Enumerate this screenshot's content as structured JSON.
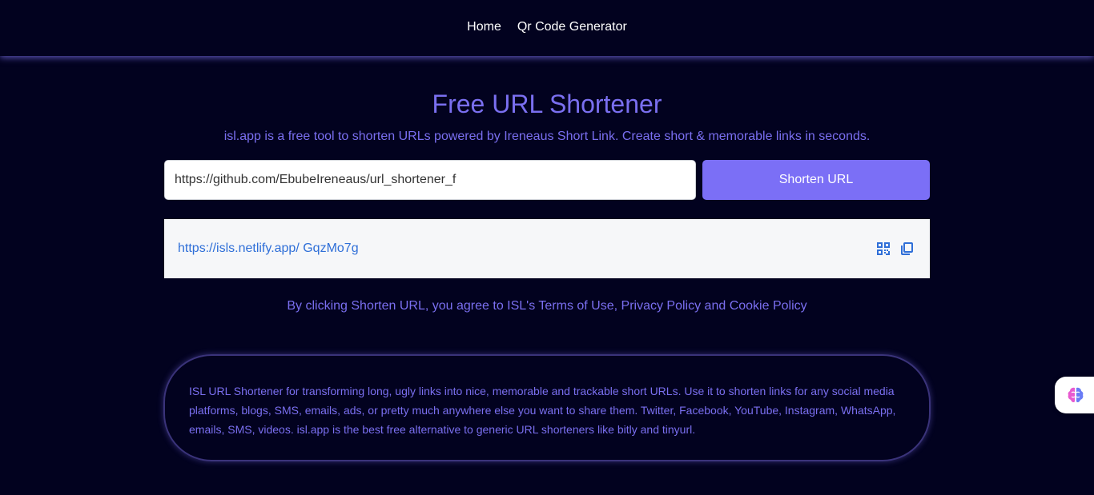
{
  "nav": {
    "items": [
      {
        "label": "Home"
      },
      {
        "label": "Qr Code Generator"
      }
    ]
  },
  "hero": {
    "title": "Free URL Shortener",
    "subtitle": "isl.app is a free tool to shorten URLs powered by Ireneaus Short Link. Create short & memorable links in seconds."
  },
  "form": {
    "url_value": "https://github.com/EbubeIreneaus/url_shortener_f",
    "shorten_label": "Shorten URL"
  },
  "result": {
    "short_url": "https://isls.netlify.app/ GqzMo7g",
    "qr_icon": "qr-code-icon",
    "copy_icon": "copy-icon"
  },
  "terms": "By clicking Shorten URL, you agree to ISL's Terms of Use, Privacy Policy and Cookie Policy",
  "info": {
    "text": "ISL URL Shortener for transforming long, ugly links into nice, memorable and trackable short URLs. Use it to shorten links for any social media platforms, blogs, SMS, emails, ads, or pretty much anywhere else you want to share them. Twitter, Facebook, YouTube, Instagram, WhatsApp, emails, SMS, videos. isl.app is the best free alternative to generic URL shorteners like bitly and tinyurl."
  },
  "widget": {
    "icon": "brain-icon"
  },
  "colors": {
    "background": "#02021f",
    "accent": "#7b6ff6",
    "link": "#2f6fd8"
  }
}
